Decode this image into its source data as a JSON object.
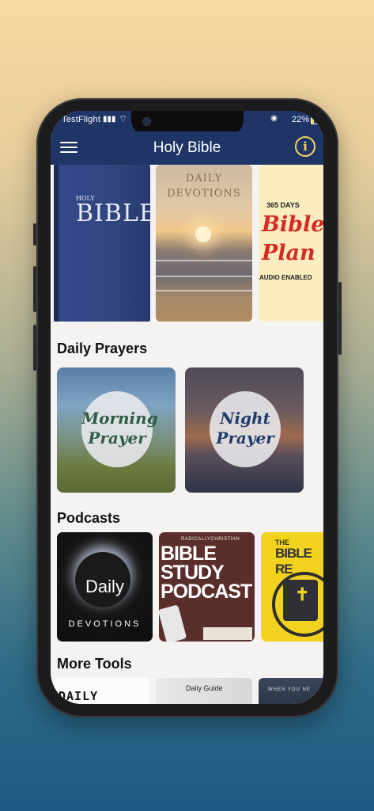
{
  "status_bar": {
    "carrier": "TestFlight",
    "battery": "22%"
  },
  "app_bar": {
    "title": "Holy Bible",
    "info_symbol": "i"
  },
  "featured": [
    {
      "small": "HOLY",
      "title": "BIBLE"
    },
    {
      "title_line1": "DAILY",
      "title_line2": "DEVOTIONS"
    },
    {
      "days": "365 DAYS",
      "line1": "Bible",
      "line2": "Plan",
      "sub": "AUDIO ENABLED"
    }
  ],
  "sections": {
    "prayers": "Daily Prayers",
    "podcasts": "Podcasts",
    "tools": "More Tools"
  },
  "prayers": [
    {
      "line1": "Morning",
      "line2": "Prayer"
    },
    {
      "line1": "Night",
      "line2": "Prayer"
    }
  ],
  "podcasts": [
    {
      "title": "Daily",
      "sub": "DEVOTIONS"
    },
    {
      "small": "RADICALLYCHRISTIAN",
      "line1": "BIBLE",
      "line2": "STUDY",
      "line3": "PODCAST"
    },
    {
      "small": "THE",
      "title": "BIBLE RE",
      "icon": "cross"
    }
  ],
  "tools": [
    {
      "title": "DAILY"
    },
    {
      "title": "Daily Guide"
    },
    {
      "title": "WHEN YOU NE"
    }
  ],
  "colors": {
    "app_bar": "#1f3566",
    "accent": "#f4d35e"
  }
}
